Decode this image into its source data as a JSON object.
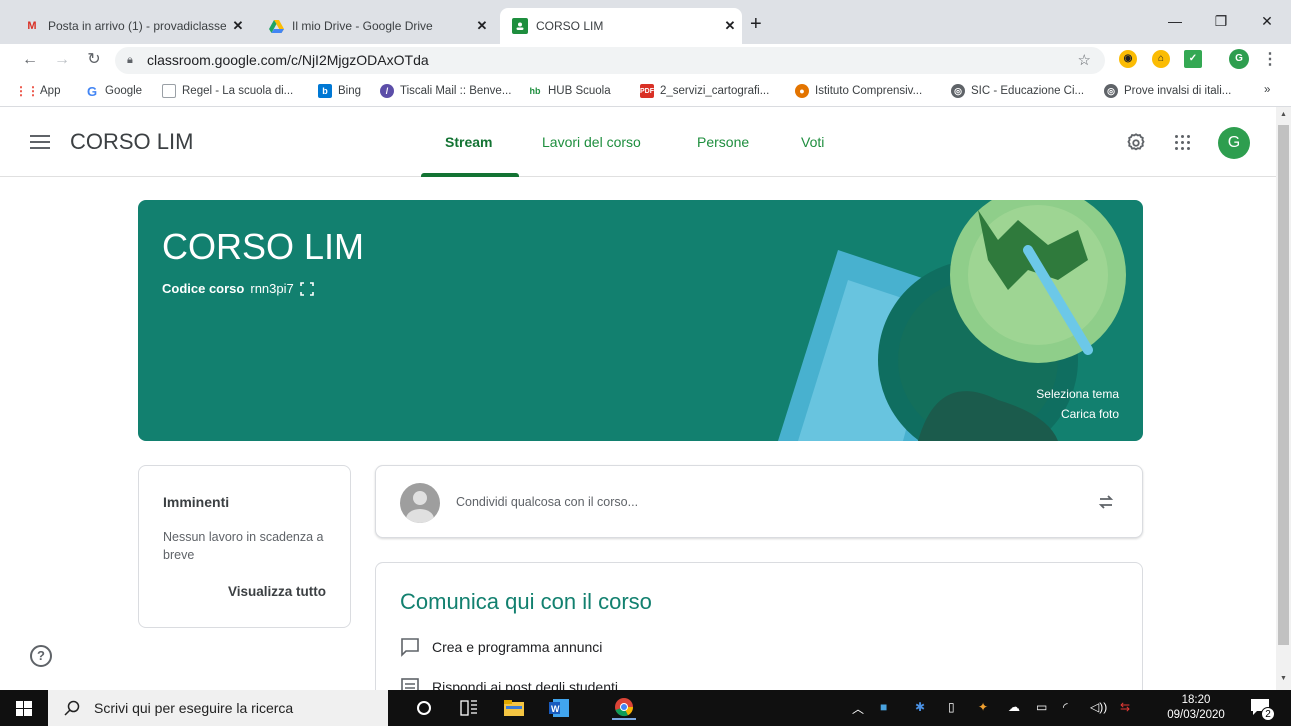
{
  "browser": {
    "tabs": [
      {
        "title": "Posta in arrivo (1) - provadiclasse",
        "favicon": "gmail-icon"
      },
      {
        "title": "Il mio Drive - Google Drive",
        "favicon": "drive-icon"
      },
      {
        "title": "CORSO LIM",
        "favicon": "classroom-icon",
        "active": true
      }
    ],
    "url": "classroom.google.com/c/NjI2MjgzODAxOTda",
    "profile_initial": "G",
    "bookmarks": [
      "App",
      "Google",
      "Regel - La scuola di...",
      "Bing",
      "Tiscali Mail :: Benve...",
      "HUB Scuola",
      "2_servizi_cartografi...",
      "Istituto Comprensiv...",
      "SIC - Educazione Ci...",
      "Prove invalsi di itali..."
    ],
    "bookmarks_more": "»"
  },
  "header": {
    "course_title": "CORSO LIM",
    "tabs": [
      "Stream",
      "Lavori del corso",
      "Persone",
      "Voti"
    ],
    "active_tab": "Stream",
    "avatar_initial": "G"
  },
  "banner": {
    "title": "CORSO LIM",
    "code_label": "Codice corso",
    "code_value": "rnn3pi7",
    "select_theme": "Seleziona tema",
    "upload_photo": "Carica foto",
    "color": "#12806f"
  },
  "upcoming": {
    "title": "Imminenti",
    "text": "Nessun lavoro in scadenza a breve",
    "view_all": "Visualizza tutto"
  },
  "share": {
    "placeholder": "Condividi qualcosa con il corso..."
  },
  "communicate": {
    "title": "Comunica qui con il corso",
    "items": [
      "Crea e programma annunci",
      "Rispondi ai post degli studenti"
    ]
  },
  "taskbar": {
    "search_placeholder": "Scrivi qui per eseguire la ricerca",
    "time": "18:20",
    "date": "09/03/2020",
    "notification_count": "2"
  }
}
